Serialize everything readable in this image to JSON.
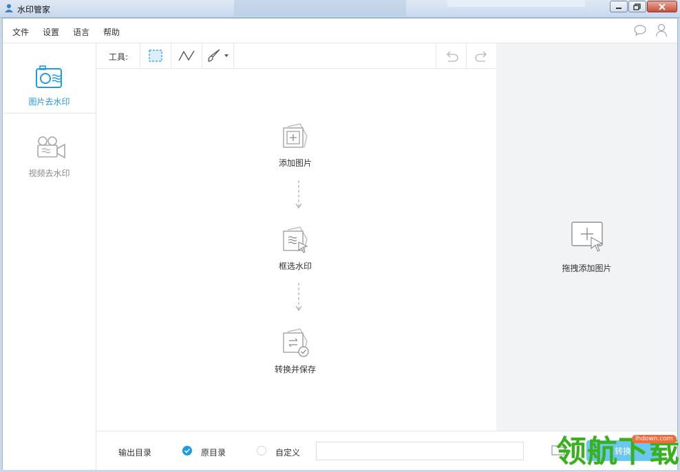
{
  "window": {
    "title": "水印管家"
  },
  "menu": {
    "items": [
      "文件",
      "设置",
      "语言",
      "帮助"
    ]
  },
  "sidebar": {
    "items": [
      {
        "label": "图片去水印",
        "active": true
      },
      {
        "label": "视频去水印",
        "active": false
      }
    ]
  },
  "toolbar": {
    "label": "工具:"
  },
  "steps": [
    {
      "label": "添加图片"
    },
    {
      "label": "框选水印"
    },
    {
      "label": "转换并保存"
    }
  ],
  "drop_panel": {
    "label": "拖拽添加图片"
  },
  "footer": {
    "output_label": "输出目录",
    "option_original": "原目录",
    "option_custom": "自定义",
    "path_value": "",
    "convert_label": "转换"
  },
  "watermark": {
    "text": "领航下载",
    "url": "lhdown.com"
  },
  "colors": {
    "accent": "#1d9be8",
    "button": "#6cc7f0",
    "panel": "#f2f3f5",
    "watermark": "#39b11c"
  }
}
